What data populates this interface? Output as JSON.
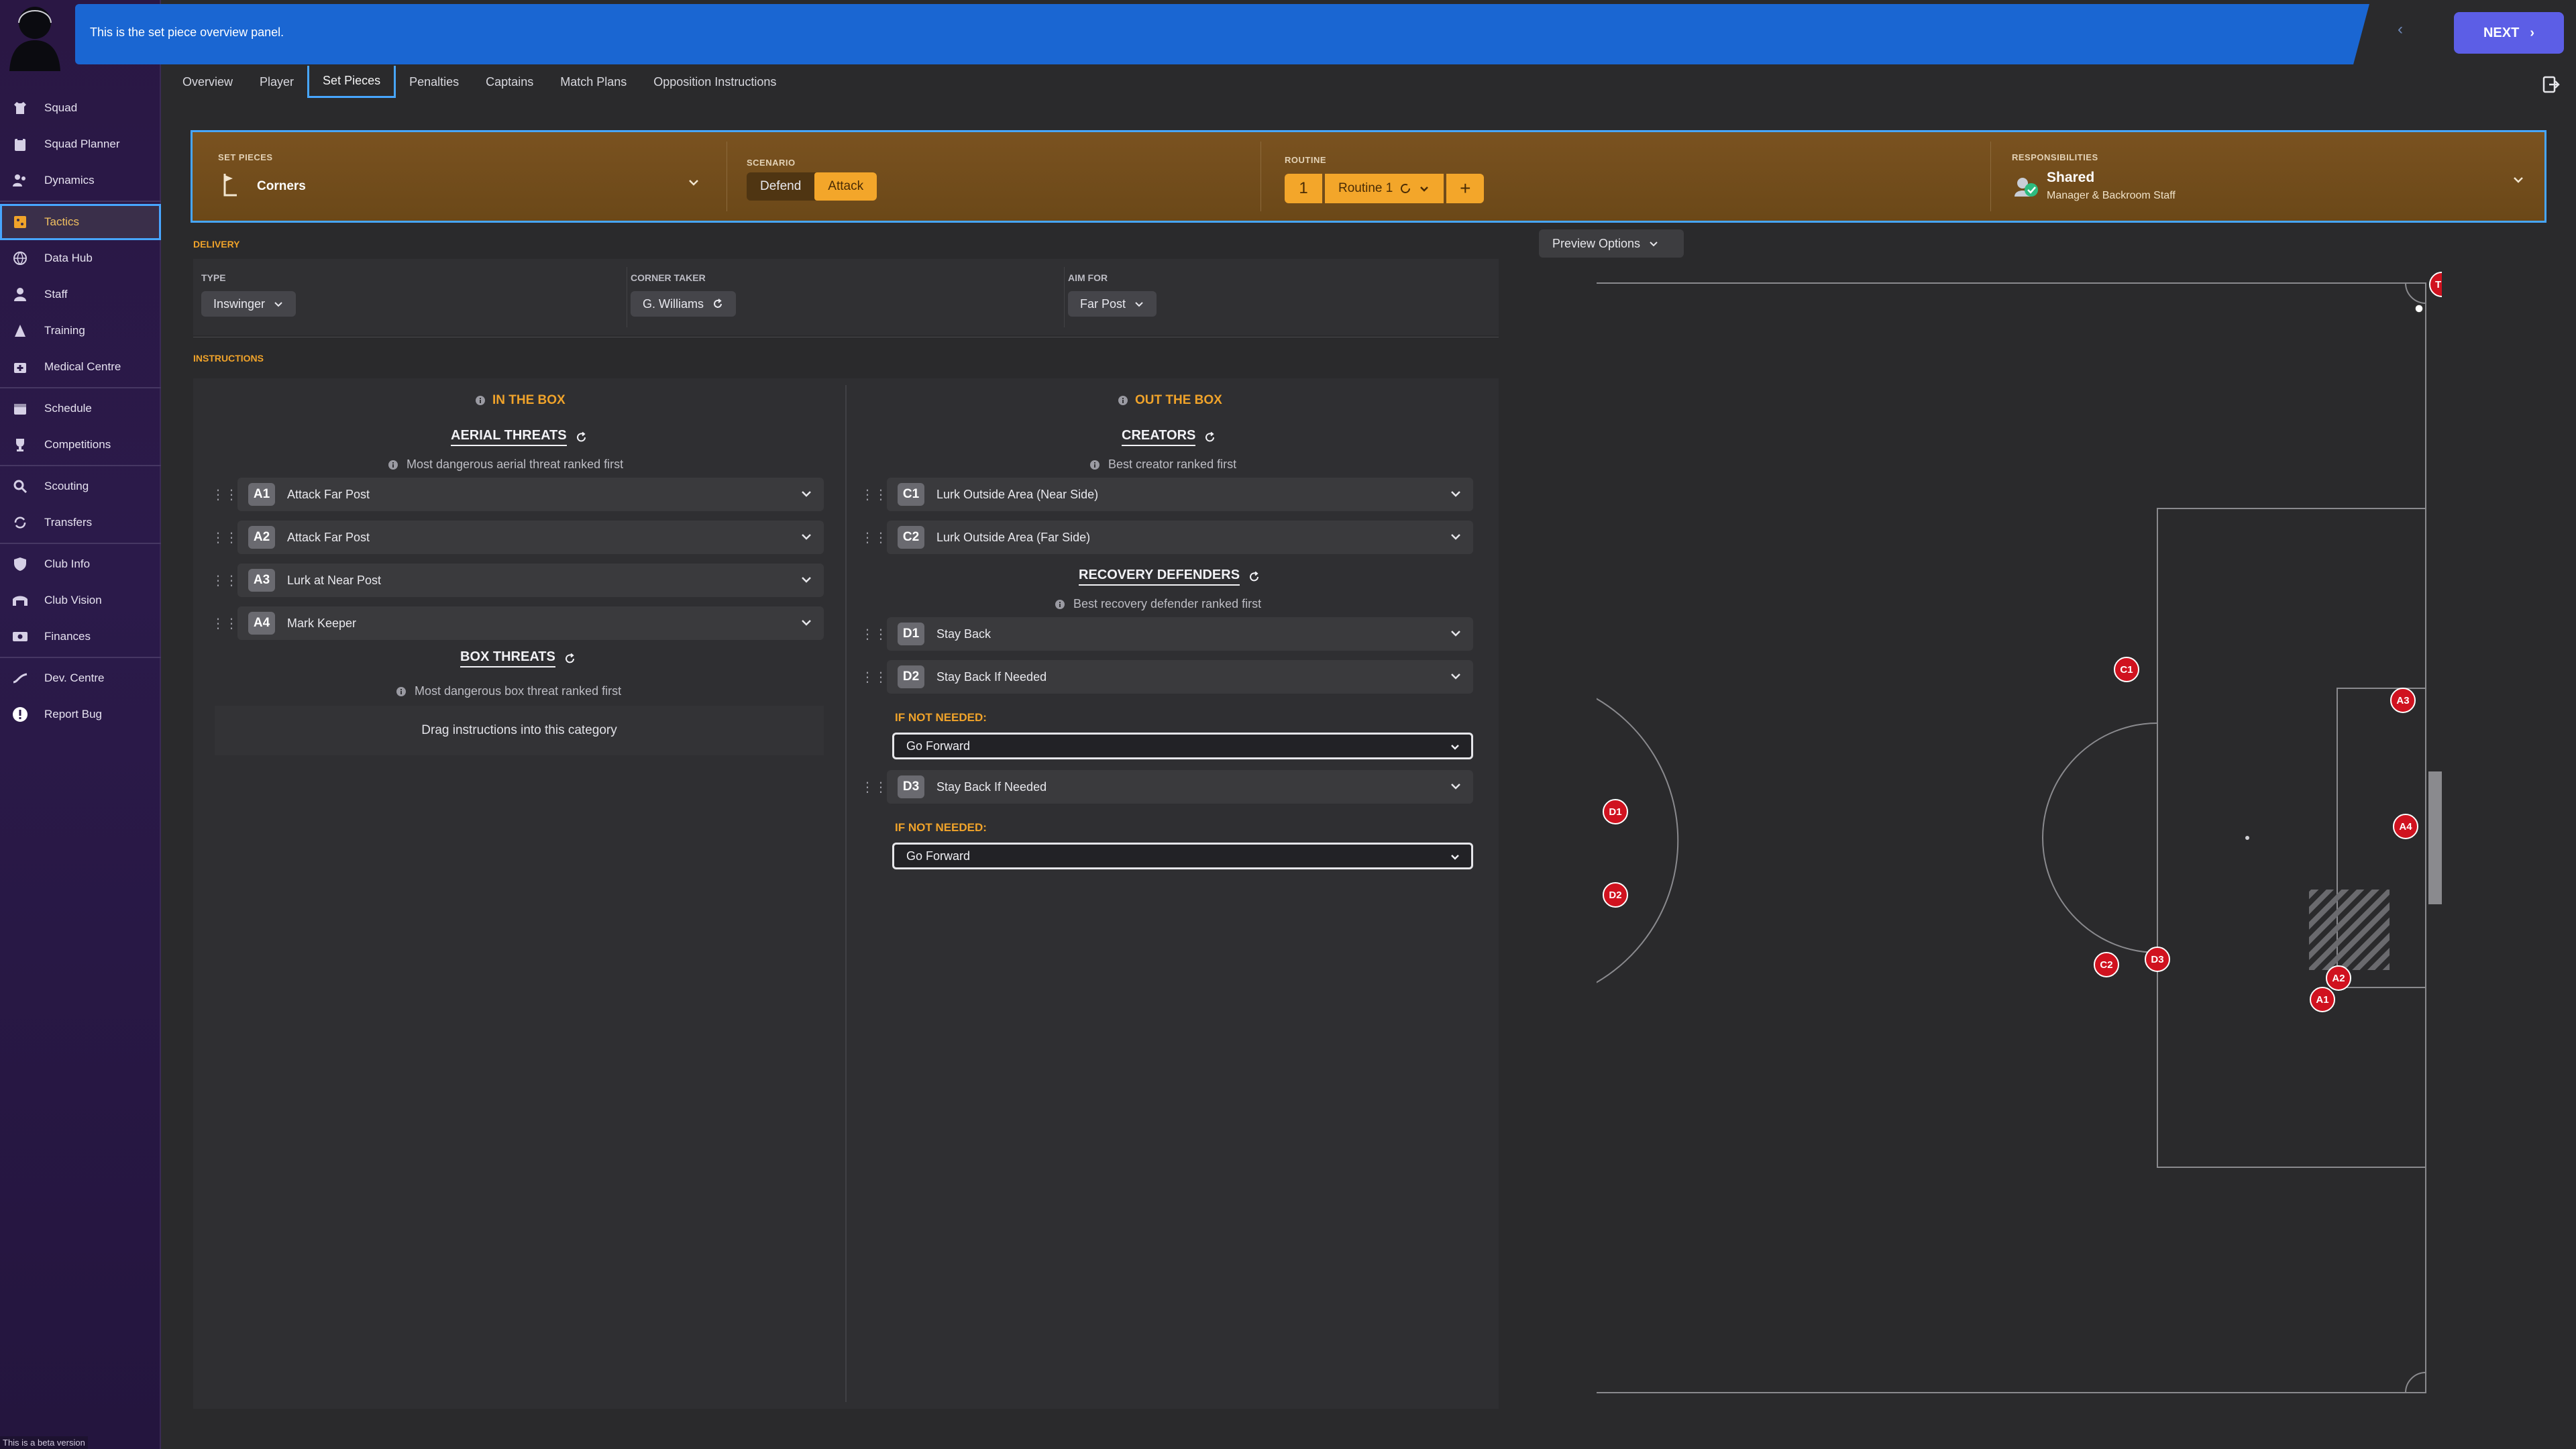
{
  "banner": {
    "text": "This is the set piece overview panel.",
    "next_label": "NEXT"
  },
  "sidebar": {
    "items": [
      {
        "label": "Squad",
        "icon": "shirt-icon"
      },
      {
        "label": "Squad Planner",
        "icon": "clipboard-icon"
      },
      {
        "label": "Dynamics",
        "icon": "people-icon"
      },
      {
        "label": "Tactics",
        "icon": "tactics-board-icon",
        "active": true
      },
      {
        "label": "Data Hub",
        "icon": "globe-icon"
      },
      {
        "label": "Staff",
        "icon": "person-icon"
      },
      {
        "label": "Training",
        "icon": "training-cone-icon"
      },
      {
        "label": "Medical Centre",
        "icon": "medical-kit-icon"
      },
      {
        "label": "Schedule",
        "icon": "calendar-icon"
      },
      {
        "label": "Competitions",
        "icon": "trophy-icon"
      },
      {
        "label": "Scouting",
        "icon": "magnifier-icon"
      },
      {
        "label": "Transfers",
        "icon": "transfer-arrows-icon"
      },
      {
        "label": "Club Info",
        "icon": "shield-icon"
      },
      {
        "label": "Club Vision",
        "icon": "stadium-icon"
      },
      {
        "label": "Finances",
        "icon": "banknote-icon"
      },
      {
        "label": "Dev. Centre",
        "icon": "growth-icon"
      },
      {
        "label": "Report Bug",
        "icon": "alert-icon"
      }
    ],
    "beta_text": "This is a beta version"
  },
  "tabs": [
    "Overview",
    "Player",
    "Set Pieces",
    "Penalties",
    "Captains",
    "Match Plans",
    "Opposition Instructions"
  ],
  "setbar": {
    "set_pieces_label": "SET PIECES",
    "set_pieces_value": "Corners",
    "scenario_label": "SCENARIO",
    "scenario_options": [
      "Defend",
      "Attack"
    ],
    "scenario_selected": "Attack",
    "routine_label": "ROUTINE",
    "routine_number": "1",
    "routine_name": "Routine 1",
    "responsibilities_label": "RESPONSIBILITIES",
    "responsibilities_value": "Shared",
    "responsibilities_sub": "Manager & Backroom Staff"
  },
  "delivery": {
    "title": "DELIVERY",
    "type_label": "TYPE",
    "type_value": "Inswinger",
    "taker_label": "CORNER TAKER",
    "taker_value": "G. Williams",
    "aim_label": "AIM FOR",
    "aim_value": "Far Post"
  },
  "instructions": {
    "title": "INSTRUCTIONS",
    "in_box": {
      "title": "IN THE BOX",
      "aerial": {
        "title": "AERIAL THREATS",
        "hint": "Most dangerous aerial threat ranked first",
        "rows": [
          {
            "badge": "A1",
            "label": "Attack Far Post"
          },
          {
            "badge": "A2",
            "label": "Attack Far Post"
          },
          {
            "badge": "A3",
            "label": "Lurk at Near Post"
          },
          {
            "badge": "A4",
            "label": "Mark Keeper"
          }
        ]
      },
      "box": {
        "title": "BOX THREATS",
        "hint": "Most dangerous box threat ranked first",
        "drop": "Drag instructions into this category"
      }
    },
    "out_box": {
      "title": "OUT THE BOX",
      "creators": {
        "title": "CREATORS",
        "hint": "Best creator ranked first",
        "rows": [
          {
            "badge": "C1",
            "label": "Lurk Outside Area (Near Side)"
          },
          {
            "badge": "C2",
            "label": "Lurk Outside Area (Far Side)"
          }
        ]
      },
      "recovery": {
        "title": "RECOVERY DEFENDERS",
        "hint": "Best recovery defender ranked first",
        "rows": [
          {
            "badge": "D1",
            "label": "Stay Back"
          },
          {
            "badge": "D2",
            "label": "Stay Back If Needed"
          },
          {
            "badge": "D3",
            "label": "Stay Back If Needed"
          }
        ],
        "if_not_label": "IF NOT NEEDED:",
        "if_not_value_1": "Go Forward",
        "if_not_value_2": "Go Forward"
      }
    }
  },
  "preview": {
    "label": "Preview Options",
    "players": [
      "TK",
      "C1",
      "A3",
      "A4",
      "D1",
      "D2",
      "C2",
      "D3",
      "A2",
      "A1"
    ]
  },
  "colors": {
    "accent": "#f0a32a",
    "focus": "#47a6ff",
    "player": "#d0121f",
    "banner": "#1a66d2"
  }
}
